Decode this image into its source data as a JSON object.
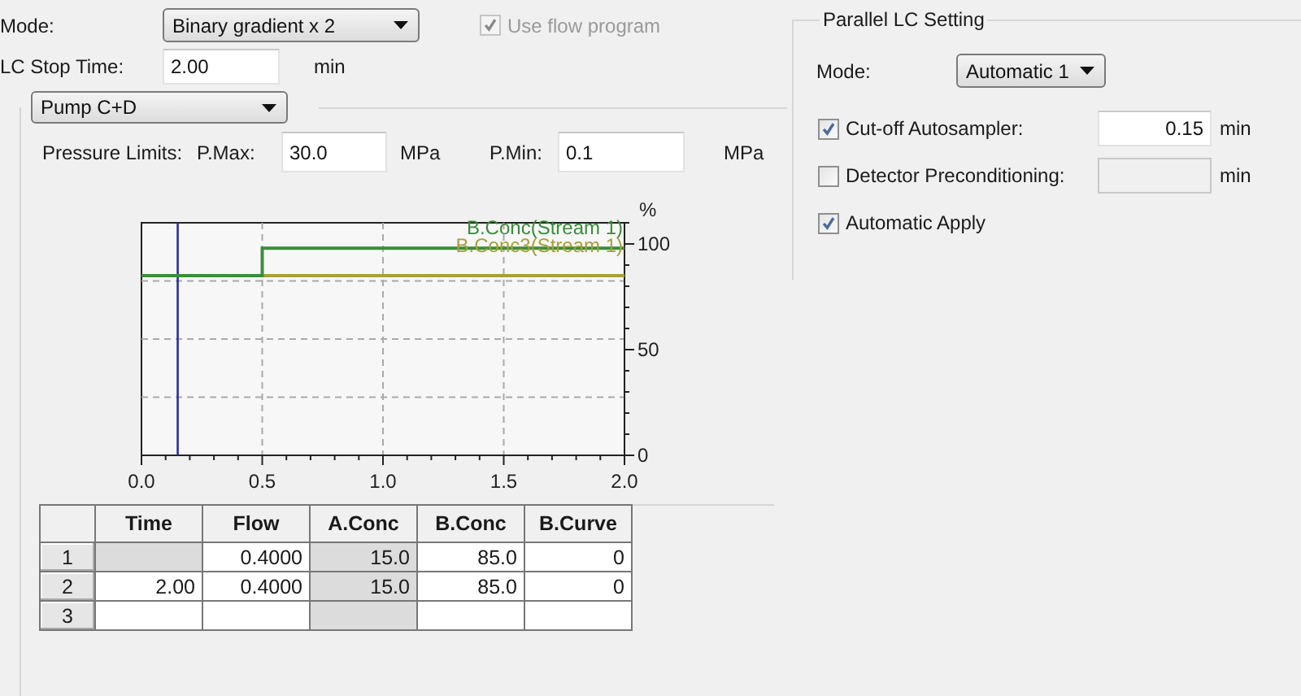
{
  "mode": {
    "label": "Mode:",
    "value": "Binary gradient x 2"
  },
  "use_flow_program": {
    "label": "Use flow program",
    "checked": true,
    "disabled": true
  },
  "lc_stop_time": {
    "label": "LC Stop Time:",
    "value": "2.00",
    "unit": "min"
  },
  "pump": {
    "value": "Pump C+D"
  },
  "pressure_limits": {
    "label": "Pressure Limits:",
    "max_label": "P.Max:",
    "max_value": "30.0",
    "max_unit": "MPa",
    "min_label": "P.Min:",
    "min_value": "0.1",
    "min_unit": "MPa"
  },
  "gradient_chart": {
    "chart_data": {
      "type": "line",
      "ylabel": "%",
      "x": [
        0,
        0.5,
        0.5,
        2
      ],
      "series": [
        {
          "name": "B.Conc(Stream 1)",
          "color": "#3c8c3c",
          "values": [
            85,
            85,
            98,
            98
          ]
        },
        {
          "name": "B.Conc3(Stream 1)",
          "color": "#a8a038",
          "values": [
            85,
            85,
            85,
            85
          ]
        }
      ],
      "xlim": [
        0,
        2
      ],
      "ylim": [
        0,
        110
      ],
      "xticks": [
        {
          "value": 0,
          "label": "0.0"
        },
        {
          "value": 0.5,
          "label": "0.5"
        },
        {
          "value": 1,
          "label": "1.0"
        },
        {
          "value": 1.5,
          "label": "1.5"
        },
        {
          "value": 2,
          "label": "2.0"
        }
      ],
      "yticks": [
        0,
        50,
        100
      ],
      "grid": true,
      "ref_lines": [
        {
          "axis": "x",
          "value": 0.15,
          "color": "#2c2ca0"
        }
      ]
    }
  },
  "table": {
    "columns": [
      "Time",
      "Flow",
      "A.Conc",
      "B.Conc",
      "B.Curve"
    ],
    "rows": [
      {
        "number": "1",
        "cells": [
          {
            "disabled": true
          },
          {
            "text": "0.4000",
            "disabled": false
          },
          {
            "text": "15.0",
            "disabled": true
          },
          {
            "text": "85.0",
            "disabled": false
          },
          {
            "text": "0",
            "disabled": false
          }
        ]
      },
      {
        "number": "2",
        "cells": [
          {
            "text": "2.00",
            "disabled": false
          },
          {
            "text": "0.4000",
            "disabled": false
          },
          {
            "text": "15.0",
            "disabled": true
          },
          {
            "text": "85.0",
            "disabled": false
          },
          {
            "text": "0",
            "disabled": false
          }
        ]
      },
      {
        "number": "3",
        "cells": [
          {
            "disabled": false
          },
          {
            "disabled": false
          },
          {
            "disabled": true
          },
          {
            "disabled": false
          },
          {
            "disabled": false
          }
        ]
      }
    ]
  },
  "parallel_lc": {
    "title": "Parallel LC Setting",
    "mode": {
      "label": "Mode:",
      "value": "Automatic 1"
    },
    "options": [
      {
        "kind": "field",
        "label": "Cut-off Autosampler:",
        "checked": true,
        "value": "0.15",
        "unit": "min",
        "disabled": false
      },
      {
        "kind": "field",
        "label": "Detector Preconditioning:",
        "checked": false,
        "unit": "min",
        "disabled": true
      },
      {
        "kind": "plain",
        "label": "Automatic Apply",
        "checked": true
      }
    ]
  }
}
